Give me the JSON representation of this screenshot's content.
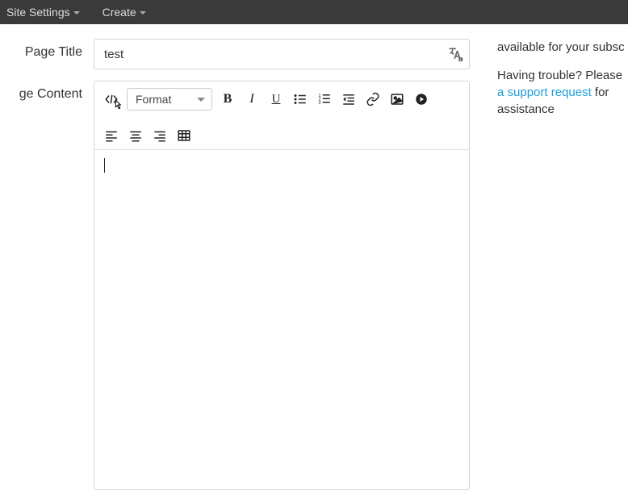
{
  "topbar": {
    "site_settings": "Site Settings",
    "create": "Create"
  },
  "form": {
    "page_title_label": "Page Title",
    "page_title_value": "test",
    "page_content_label": "ge Content"
  },
  "toolbar": {
    "format_label": "Format"
  },
  "sidebar": {
    "line1": "available for your subsc",
    "line2a": "Having trouble? Please ",
    "link_text": "a support request",
    "line2b": " for assistance"
  }
}
